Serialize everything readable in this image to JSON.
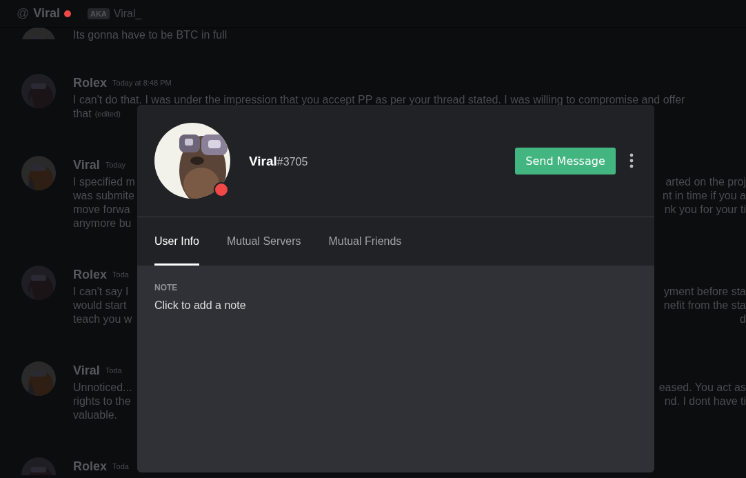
{
  "header": {
    "at": "@",
    "name": "Viral",
    "color": "#f04747",
    "aka_label": "AKA",
    "aka": "Viral_"
  },
  "messages": [
    {
      "lines": [
        {
          "left": "Its gonna have to be BTC in full"
        }
      ]
    },
    {
      "author": "Rolex",
      "timestamp": "Today at 8:48 PM",
      "lines": [
        {
          "left": "I can't do that. I was under the impression that you accept PP as per your thread stated. I was willing to compromise and offer"
        },
        {
          "left": "that",
          "edited": "(edited)"
        }
      ]
    },
    {
      "author": "Viral",
      "timestamp": "Today",
      "lines": [
        {
          "left": "I specified m",
          "right": "arted on the proj"
        },
        {
          "left": "was submite",
          "right": "nt in time if you a"
        },
        {
          "left": "move forwa",
          "right": "nk you for your ti"
        },
        {
          "left": "anymore bu"
        }
      ]
    },
    {
      "author": "Rolex",
      "timestamp": "Toda",
      "lines": [
        {
          "left": "I can't say I",
          "right": "yment before sta"
        },
        {
          "left": "would start",
          "right": "nefit from the sta"
        },
        {
          "left": "teach you w",
          "right": "d"
        }
      ]
    },
    {
      "author": "Viral",
      "timestamp": "Toda",
      "lines": [
        {
          "left": "Unnoticed...",
          "right": "eased. You act as"
        },
        {
          "left": "rights to the",
          "right": "nd. I dont have ti"
        },
        {
          "left": "valuable."
        }
      ]
    },
    {
      "author": "Rolex",
      "timestamp": "Toda"
    }
  ],
  "profile": {
    "username": "Viral",
    "discriminator": "#3705",
    "color": "#f04747",
    "button": "Send Message",
    "tabs": [
      {
        "label": "User Info",
        "selected": true
      },
      {
        "label": "Mutual Servers",
        "selected": false
      },
      {
        "label": "Mutual Friends",
        "selected": false
      }
    ],
    "note_label": "NOTE",
    "note_placeholder": "Click to add a note"
  }
}
